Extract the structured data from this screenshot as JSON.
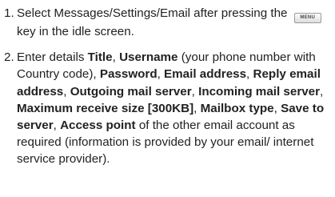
{
  "steps": [
    {
      "number": "1.",
      "text_before_key": "Select Messages/Settings/Email after pressing the",
      "key_label": "MENU",
      "text_after_key": "key in the idle screen."
    },
    {
      "number": "2.",
      "intro": "Enter details",
      "fields": [
        "Title",
        "Username",
        "Password",
        "Email address",
        "Reply email address",
        "Outgoing mail server",
        "Incoming mail server",
        "Maximum receive size [300KB]",
        "Mailbox type",
        "Save to server",
        "Access point"
      ],
      "username_note": "(your phone number with Country code)",
      "outro": "of the other email account as required (information is provided by your email/ internet service provider)."
    }
  ]
}
